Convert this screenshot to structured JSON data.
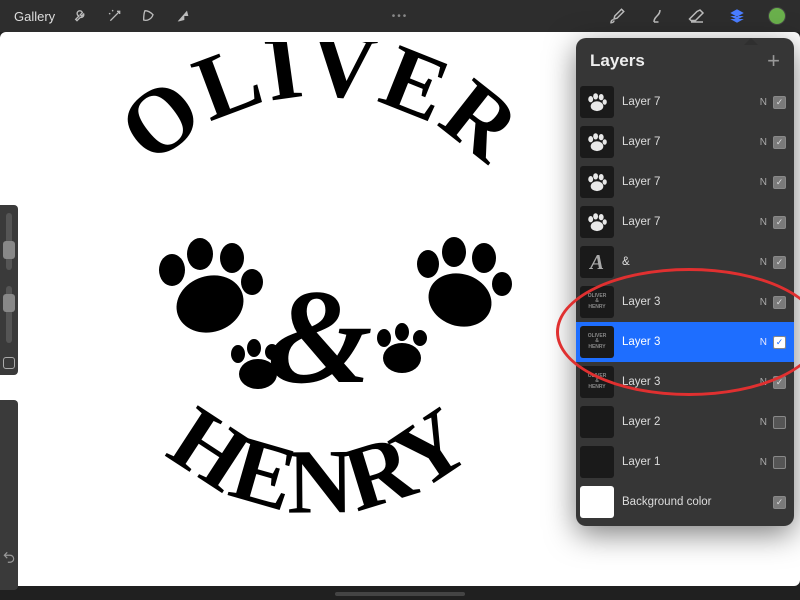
{
  "toolbar": {
    "gallery_label": "Gallery",
    "center_dots": "•••"
  },
  "panel": {
    "title": "Layers"
  },
  "layers": [
    {
      "name": "Layer 7",
      "blend": "N",
      "visible": true,
      "thumb": "paw",
      "selected": false
    },
    {
      "name": "Layer 7",
      "blend": "N",
      "visible": true,
      "thumb": "paw",
      "selected": false
    },
    {
      "name": "Layer 7",
      "blend": "N",
      "visible": true,
      "thumb": "paw",
      "selected": false
    },
    {
      "name": "Layer 7",
      "blend": "N",
      "visible": true,
      "thumb": "paw",
      "selected": false
    },
    {
      "name": "&",
      "blend": "N",
      "visible": true,
      "thumb": "amp",
      "selected": false
    },
    {
      "name": "Layer 3",
      "blend": "N",
      "visible": true,
      "thumb": "design",
      "selected": false
    },
    {
      "name": "Layer 3",
      "blend": "N",
      "visible": true,
      "thumb": "design",
      "selected": true
    },
    {
      "name": "Layer 3",
      "blend": "N",
      "visible": true,
      "thumb": "design",
      "selected": false
    },
    {
      "name": "Layer 2",
      "blend": "N",
      "visible": false,
      "thumb": "blank",
      "selected": false
    },
    {
      "name": "Layer 1",
      "blend": "N",
      "visible": false,
      "thumb": "blank",
      "selected": false
    },
    {
      "name": "Background color",
      "blend": "",
      "visible": true,
      "thumb": "bg",
      "selected": false
    }
  ],
  "artwork": {
    "top_text": "OLIVER",
    "mid_text": "&",
    "bottom_text": "HENRY"
  },
  "colors": {
    "accent": "#1e6eff",
    "swatch": "#6ab04c"
  }
}
